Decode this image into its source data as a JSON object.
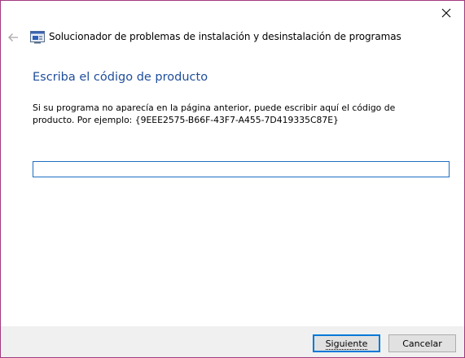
{
  "window": {
    "title": "Solucionador de problemas de instalación y desinstalación de programas",
    "close_symbol": "×",
    "back_symbol": "←",
    "icons": {
      "close": "close-icon",
      "back": "back-arrow-icon",
      "app": "troubleshooter-app-icon"
    }
  },
  "main": {
    "heading": "Escriba el código de producto",
    "instructions": "Si su programa no aparecía en la página anterior, puede escribir aquí el código de producto. Por ejemplo: {9EEE2575-B66F-43F7-A455-7D419335C87E}",
    "product_code_value": "",
    "product_code_placeholder": ""
  },
  "footer": {
    "next_label": "Siguiente",
    "cancel_label": "Cancelar"
  },
  "colors": {
    "heading": "#1f4e9a",
    "window_border": "#a2397f",
    "input_border": "#1e6ec0",
    "default_button_border": "#0078d7",
    "footer_background": "#f0f0f0"
  }
}
